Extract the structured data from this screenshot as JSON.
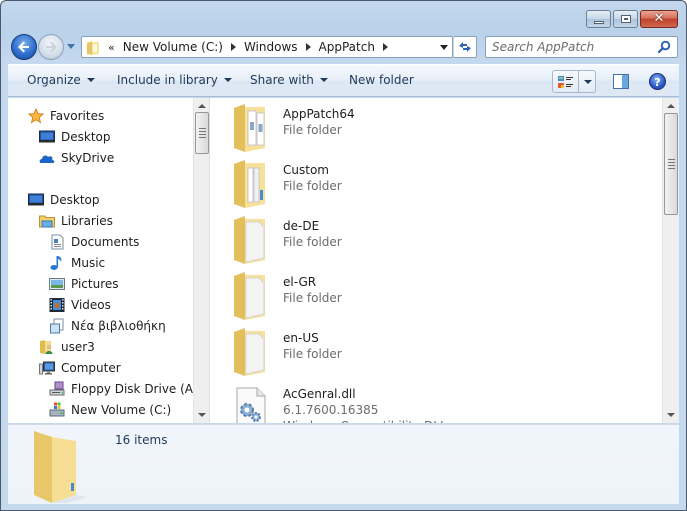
{
  "window": {
    "caption_buttons": {
      "minimize_icon": "minimize-icon",
      "maximize_icon": "maximize-icon",
      "close_icon": "close-icon",
      "close_glyph": "✕"
    }
  },
  "navigation": {
    "back_icon": "back-arrow-icon",
    "forward_icon": "forward-arrow-icon",
    "recent_pages_icon": "chevron-down-icon"
  },
  "address_bar": {
    "overflow_glyph": "«",
    "breadcrumbs": [
      "New Volume (C:)",
      "Windows",
      "AppPatch"
    ]
  },
  "search": {
    "placeholder": "Search AppPatch"
  },
  "command_bar": {
    "organize": "Organize",
    "include_in_library": "Include in library",
    "share_with": "Share with",
    "new_folder": "New folder",
    "help_glyph": "?"
  },
  "nav_pane": {
    "items": [
      {
        "label": "Favorites",
        "icon": "star-icon"
      },
      {
        "label": "Desktop",
        "icon": "desktop-icon"
      },
      {
        "label": "SkyDrive",
        "icon": "cloud-icon"
      },
      {
        "label": "Desktop",
        "icon": "desktop-icon"
      },
      {
        "label": "Libraries",
        "icon": "libraries-icon"
      },
      {
        "label": "Documents",
        "icon": "document-icon"
      },
      {
        "label": "Music",
        "icon": "music-note-icon"
      },
      {
        "label": "Pictures",
        "icon": "picture-icon"
      },
      {
        "label": "Videos",
        "icon": "film-icon"
      },
      {
        "label": "Νέα βιβλιοθήκη",
        "icon": "library-icon"
      },
      {
        "label": "user3",
        "icon": "user-folder-icon"
      },
      {
        "label": "Computer",
        "icon": "computer-icon"
      },
      {
        "label": "Floppy Disk Drive (A:)",
        "icon": "floppy-drive-icon"
      },
      {
        "label": "New Volume (C:)",
        "icon": "hard-drive-icon"
      }
    ]
  },
  "files": [
    {
      "name": "AppPatch64",
      "type": "File folder",
      "icon": "folder-with-files-icon"
    },
    {
      "name": "Custom",
      "type": "File folder",
      "icon": "folder-with-files-icon"
    },
    {
      "name": "de-DE",
      "type": "File folder",
      "icon": "folder-icon"
    },
    {
      "name": "el-GR",
      "type": "File folder",
      "icon": "folder-icon"
    },
    {
      "name": "en-US",
      "type": "File folder",
      "icon": "folder-icon"
    },
    {
      "name": "AcGenral.dll",
      "type": "6.1.7600.16385",
      "description": "Windows Compatibility DLL",
      "icon": "dll-gear-icon"
    }
  ],
  "details_pane": {
    "item_count": "16 items"
  },
  "colors": {
    "accent": "#1e395b",
    "frame": "#b9d1ea",
    "close_button": "#c0412a",
    "folder": "#f2d47b"
  }
}
